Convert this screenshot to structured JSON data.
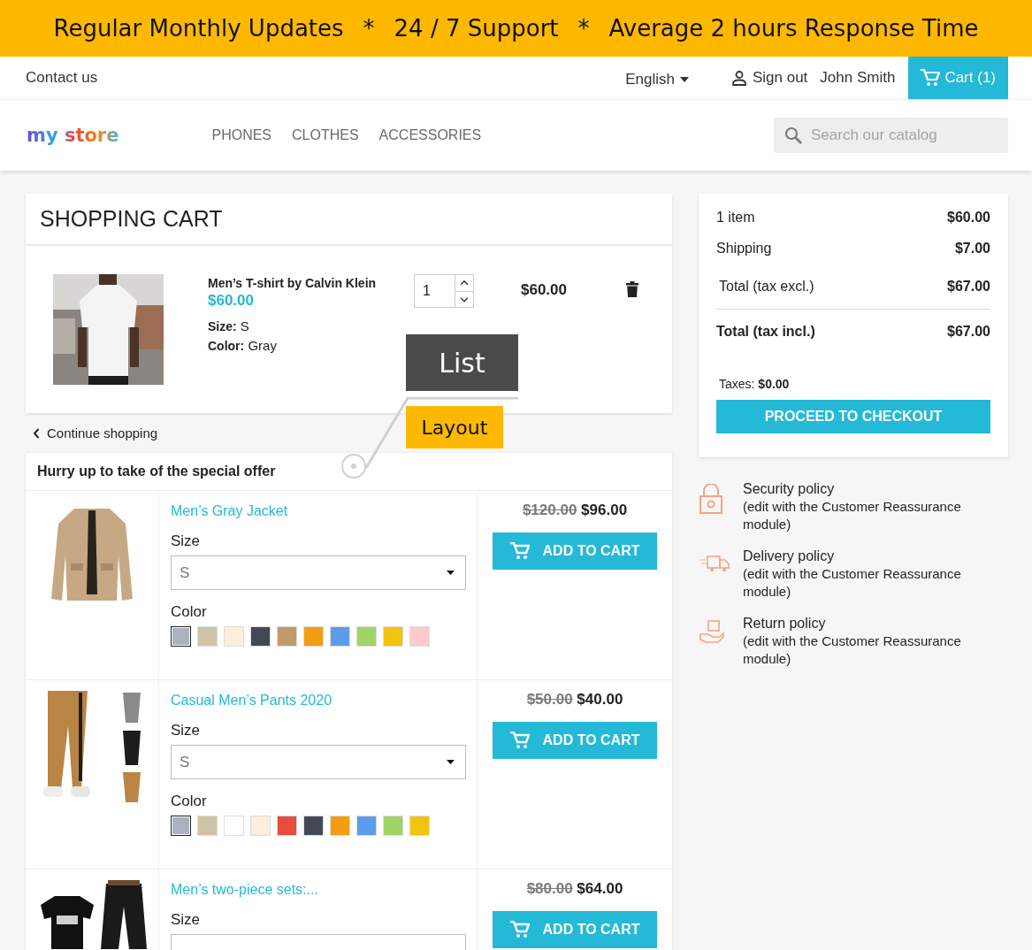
{
  "promo_banner": {
    "items": [
      "Regular Monthly Updates",
      "*",
      "24 / 7 Support",
      "*",
      "Average 2 hours Response Time"
    ]
  },
  "top_bar": {
    "contact": "Contact us",
    "language": "English",
    "sign_out": "Sign out",
    "user": "John Smith",
    "cart": "Cart (1)"
  },
  "header": {
    "logo": "my store",
    "menu": [
      "PHONES",
      "CLOTHES",
      "ACCESSORIES"
    ],
    "search": {
      "placeholder": "Search our catalog"
    }
  },
  "cart": {
    "title": "SHOPPING CART",
    "items": [
      {
        "name": "Men’s T-shirt by Calvin Klein",
        "price": "$60.00",
        "attributes": [
          {
            "label": "Size:",
            "value": "S"
          },
          {
            "label": "Color:",
            "value": "Gray"
          }
        ],
        "quantity": "1",
        "total": "$60.00"
      }
    ]
  },
  "continue_shopping": "Continue shopping",
  "special_offer": {
    "title": "Hurry up to take of the special offer",
    "products": [
      {
        "kind": "jacket",
        "name": "Men’s Gray Jacket",
        "old_price": "$120.00",
        "price": "$96.00",
        "size_label": "Size",
        "size": "S",
        "color_label": "Color",
        "colors": [
          {
            "color": "#aab2bd",
            "selected": true
          },
          {
            "color": "#cfc4a6",
            "selected": false
          },
          {
            "color": "#fbeedb",
            "selected": false
          },
          {
            "color": "#434a54",
            "selected": false
          },
          {
            "color": "#c19a6b",
            "selected": false
          },
          {
            "color": "#f39d12",
            "selected": false
          },
          {
            "color": "#5d9cec",
            "selected": false
          },
          {
            "color": "#a0d468",
            "selected": false
          },
          {
            "color": "#f1c40f",
            "selected": false
          },
          {
            "color": "#fccacd",
            "selected": false
          }
        ],
        "button": "ADD TO CART"
      },
      {
        "kind": "pants",
        "name": "Casual Men’s Pants 2020",
        "old_price": "$50.00",
        "price": "$40.00",
        "size_label": "Size",
        "size": "S",
        "color_label": "Color",
        "colors": [
          {
            "color": "#aab2bd",
            "selected": true
          },
          {
            "color": "#cfc4a6",
            "selected": false
          },
          {
            "color": "#ffffff",
            "selected": false
          },
          {
            "color": "#fbeedb",
            "selected": false
          },
          {
            "color": "#e84c3d",
            "selected": false
          },
          {
            "color": "#434a54",
            "selected": false
          },
          {
            "color": "#f39d12",
            "selected": false
          },
          {
            "color": "#5d9cec",
            "selected": false
          },
          {
            "color": "#a0d468",
            "selected": false
          },
          {
            "color": "#f1c40f",
            "selected": false
          }
        ],
        "button": "ADD TO CART"
      },
      {
        "kind": "set",
        "name": "Men’s two-piece sets:...",
        "old_price": "$80.00",
        "price": "$64.00",
        "size_label": "Size",
        "button": "ADD TO CART"
      }
    ]
  },
  "summary": {
    "lines": [
      {
        "kind": "item",
        "label": "1 item",
        "value": "$60.00"
      },
      {
        "kind": "item",
        "label": "Shipping",
        "value": "$7.00"
      },
      {
        "kind": "total",
        "label": "Total (tax excl.)",
        "value": "$67.00"
      },
      {
        "kind": "grand",
        "label": "Total (tax incl.)",
        "value": "$67.00"
      }
    ],
    "taxes": {
      "label": "Taxes:",
      "value": "$0.00"
    },
    "checkout": "PROCEED TO CHECKOUT"
  },
  "reassurance": [
    {
      "kind": "security",
      "title": "Security policy",
      "text": "(edit with the Customer Reassurance module)"
    },
    {
      "kind": "delivery",
      "title": "Delivery policy",
      "text": "(edit with the Customer Reassurance module)"
    },
    {
      "kind": "return",
      "title": "Return policy",
      "text": "(edit with the Customer Reassurance module)"
    }
  ],
  "annotations": {
    "list": "List",
    "layout": "Layout"
  }
}
